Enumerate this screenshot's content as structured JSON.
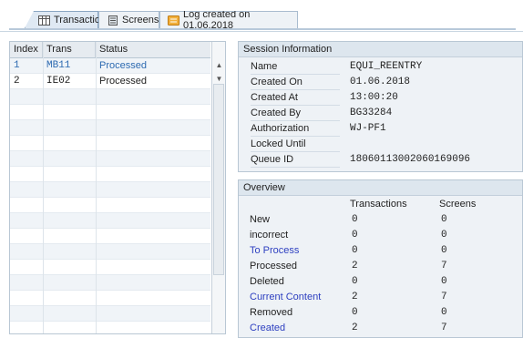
{
  "tabs": [
    {
      "label": "Transactions",
      "icon": "table-icon",
      "active": true
    },
    {
      "label": "Screens",
      "icon": "screens-icon",
      "active": false
    },
    {
      "label": "Log created on 01.06.2018",
      "icon": "log-icon",
      "active": false
    }
  ],
  "table": {
    "headers": {
      "index": "Index",
      "trans": "Trans",
      "status": "Status"
    },
    "rows": [
      {
        "index": "1",
        "trans": "MB11",
        "status": "Processed"
      },
      {
        "index": "2",
        "trans": "IE02",
        "status": "Processed"
      }
    ]
  },
  "session": {
    "title": "Session Information",
    "fields": [
      {
        "key": "Name",
        "value": "EQUI_REENTRY"
      },
      {
        "key": "Created On",
        "value": "01.06.2018"
      },
      {
        "key": "Created At",
        "value": "13:00:20"
      },
      {
        "key": "Created By",
        "value": "BG33284"
      },
      {
        "key": "Authorization",
        "value": "WJ-PF1"
      },
      {
        "key": "Locked Until",
        "value": ""
      },
      {
        "key": "Queue ID",
        "value": "18060113002060169096"
      }
    ]
  },
  "overview": {
    "title": "Overview",
    "col_transactions": "Transactions",
    "col_screens": "Screens",
    "rows": [
      {
        "label": "New",
        "transactions": "0",
        "screens": "0",
        "highlight": false
      },
      {
        "label": "incorrect",
        "transactions": "0",
        "screens": "0",
        "highlight": false
      },
      {
        "label": "To Process",
        "transactions": "0",
        "screens": "0",
        "highlight": true
      },
      {
        "label": "Processed",
        "transactions": "2",
        "screens": "7",
        "highlight": false
      },
      {
        "label": "Deleted",
        "transactions": "0",
        "screens": "0",
        "highlight": false
      },
      {
        "label": "Current Content",
        "transactions": "2",
        "screens": "7",
        "highlight": true
      },
      {
        "label": "Removed",
        "transactions": "0",
        "screens": "0",
        "highlight": false
      },
      {
        "label": "Created",
        "transactions": "2",
        "screens": "7",
        "highlight": true
      }
    ]
  },
  "colors": {
    "link": "#2d6ab1",
    "highlight_label": "#2d3fc0",
    "panel_bg": "#eef2f6"
  }
}
